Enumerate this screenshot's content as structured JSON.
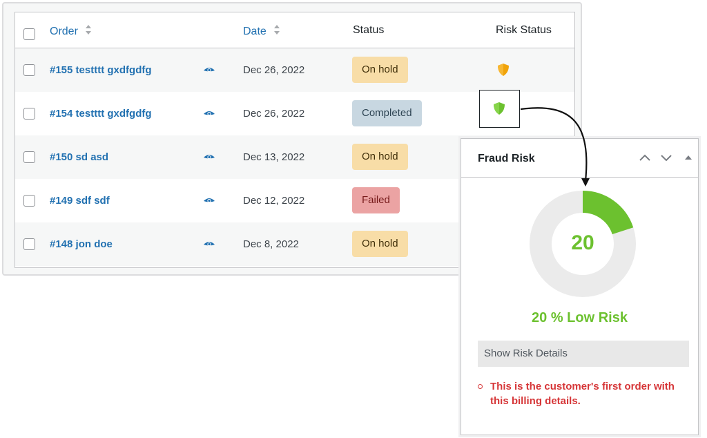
{
  "table": {
    "headers": {
      "order": "Order",
      "date": "Date",
      "status": "Status",
      "risk_status": "Risk Status"
    },
    "rows": [
      {
        "order": "#155 testttt gxdfgdfg",
        "date": "Dec 26, 2022",
        "status": "On hold",
        "risk_color": "#f0a30a"
      },
      {
        "order": "#154 testttt gxdfgdfg",
        "date": "Dec 26, 2022",
        "status": "Completed",
        "risk_color": "#6cc12f"
      },
      {
        "order": "#150 sd asd",
        "date": "Dec 13, 2022",
        "status": "On hold"
      },
      {
        "order": "#149 sdf sdf",
        "date": "Dec 12, 2022",
        "status": "Failed"
      },
      {
        "order": "#148 jon doe",
        "date": "Dec 8, 2022",
        "status": "On hold"
      }
    ]
  },
  "fraud_panel": {
    "title": "Fraud Risk",
    "score": "20",
    "score_fraction": 0.2,
    "risk_label": "20 % Low Risk",
    "details_button": "Show Risk Details",
    "notes": [
      "This is the customer's first order with this billing details."
    ],
    "accent_color": "#6cc12f",
    "note_color": "#d63638"
  },
  "icons": {
    "sort": "sort-arrows-icon",
    "view": "eye-icon",
    "risk": "shield-icon",
    "panel_controls": [
      "chevron-up-icon",
      "chevron-down-icon",
      "caret-up-icon"
    ]
  }
}
